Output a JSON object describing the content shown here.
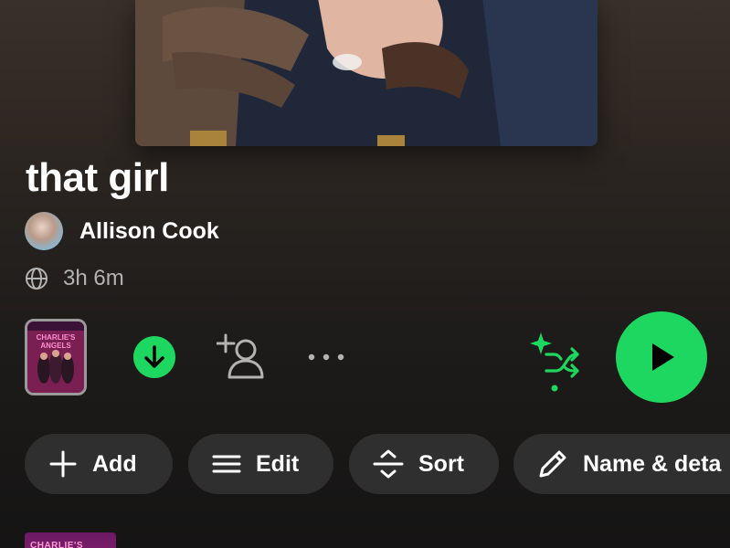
{
  "playlist": {
    "title": "that girl",
    "owner_name": "Allison Cook",
    "duration": "3h 6m"
  },
  "actions": {
    "add_label": "Add",
    "edit_label": "Edit",
    "sort_label": "Sort",
    "name_details_label": "Name & deta"
  },
  "thumbnail": {
    "title_text": "CHARLIE'S ANGELS"
  },
  "track_list": {
    "first_thumb_text": "CHARLIE'S"
  },
  "icons": {
    "visibility": "globe-icon",
    "download": "download-icon",
    "invite": "add-user-icon",
    "more": "more-icon",
    "shuffle": "smart-shuffle-icon",
    "play": "play-icon"
  },
  "colors": {
    "accent": "#1ed760",
    "pill_bg": "#2f2f2f",
    "secondary_text": "#b3b3b3"
  }
}
